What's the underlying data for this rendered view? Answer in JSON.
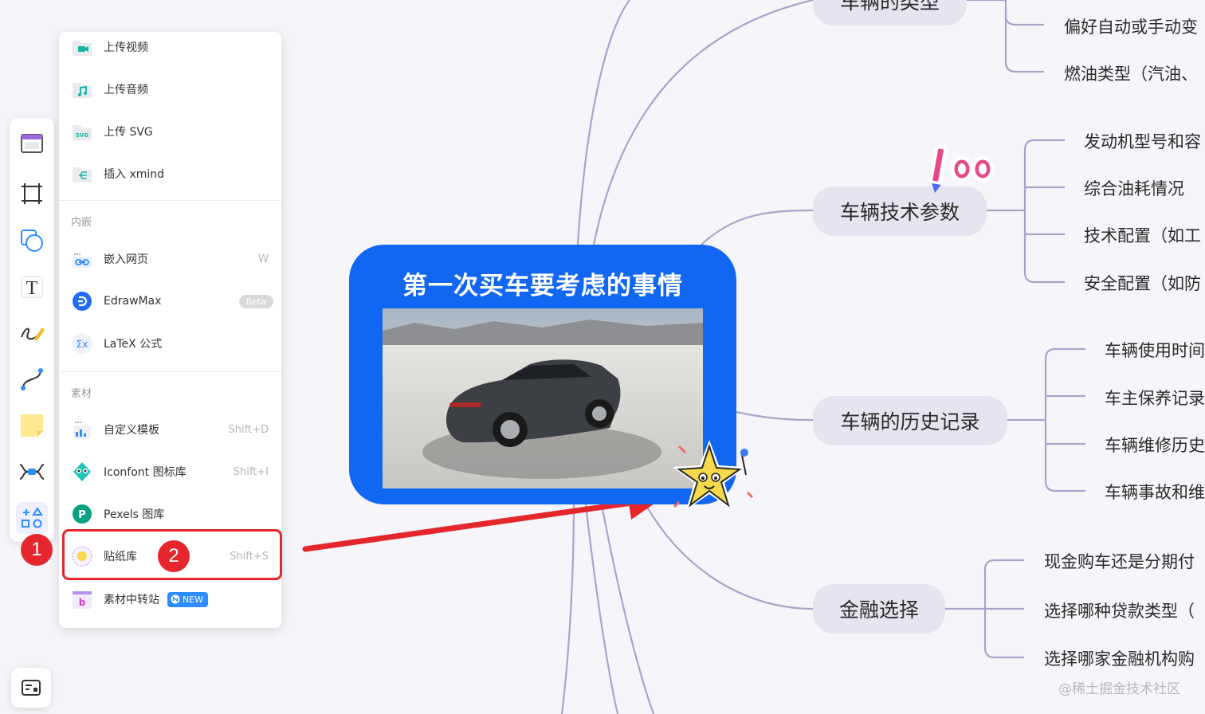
{
  "menu": {
    "upload_items": [
      {
        "label": "上传视频",
        "icon": "upload-video-icon"
      },
      {
        "label": "上传音频",
        "icon": "upload-audio-icon"
      },
      {
        "label": "上传 SVG",
        "icon": "upload-svg-icon",
        "icon_text": "SVG"
      },
      {
        "label": "插入 xmind",
        "icon": "insert-xmind-icon"
      }
    ],
    "embed_section_title": "内嵌",
    "embed_items": [
      {
        "label": "嵌入网页",
        "shortcut": "W",
        "icon": "link-icon"
      },
      {
        "label": "EdrawMax",
        "badge": "Beta",
        "icon": "edrawmax-icon"
      },
      {
        "label": "LaTeX 公式",
        "icon": "latex-formula-icon",
        "icon_text": "Σx"
      }
    ],
    "material_section_title": "素材",
    "material_items": [
      {
        "label": "自定义模板",
        "shortcut": "Shift+D",
        "icon": "template-icon"
      },
      {
        "label": "Iconfont 图标库",
        "shortcut": "Shift+I",
        "icon": "iconfont-icon"
      },
      {
        "label": "Pexels 图库",
        "icon": "pexels-icon",
        "icon_text": "P"
      },
      {
        "label": "贴纸库",
        "shortcut": "Shift+S",
        "icon": "sticker-icon"
      },
      {
        "label": "素材中转站",
        "badge": "NEW",
        "icon": "material-transfer-icon",
        "icon_text": "b"
      }
    ]
  },
  "annotations": {
    "step1": "1",
    "step2": "2"
  },
  "toolbar": {
    "tools": [
      "frame-icon",
      "crop-frame-icon",
      "shape-icon",
      "text-icon",
      "pen-icon",
      "connector-icon",
      "sticky-note-icon",
      "mindmap-icon",
      "more-widgets-icon"
    ],
    "text_tool_glyph": "T"
  },
  "mindmap": {
    "central_title": "第一次买车要考虑的事情",
    "topics": [
      {
        "label": "车辆的类型",
        "subtopics": [
          "偏好自动或手动变",
          "燃油类型（汽油、"
        ]
      },
      {
        "label": "车辆技术参数",
        "subtopics": [
          "发动机型号和容",
          "综合油耗情况",
          "技术配置（如工",
          "安全配置（如防"
        ]
      },
      {
        "label": "车辆的历史记录",
        "subtopics": [
          "车辆使用时间",
          "车主保养记录",
          "车辆维修历史",
          "车辆事故和维"
        ]
      },
      {
        "label": "金融选择",
        "subtopics": [
          "现金购车还是分期付",
          "选择哪种贷款类型（",
          "选择哪家金融机构购"
        ]
      }
    ],
    "sticker_text": "100"
  },
  "colors": {
    "accent_red": "#e5262d",
    "central_blue": "#1267f2",
    "branch_line": "#a9a4c8",
    "topic_bg": "#e5e5ef"
  },
  "watermark": "@稀土掘金技术社区"
}
